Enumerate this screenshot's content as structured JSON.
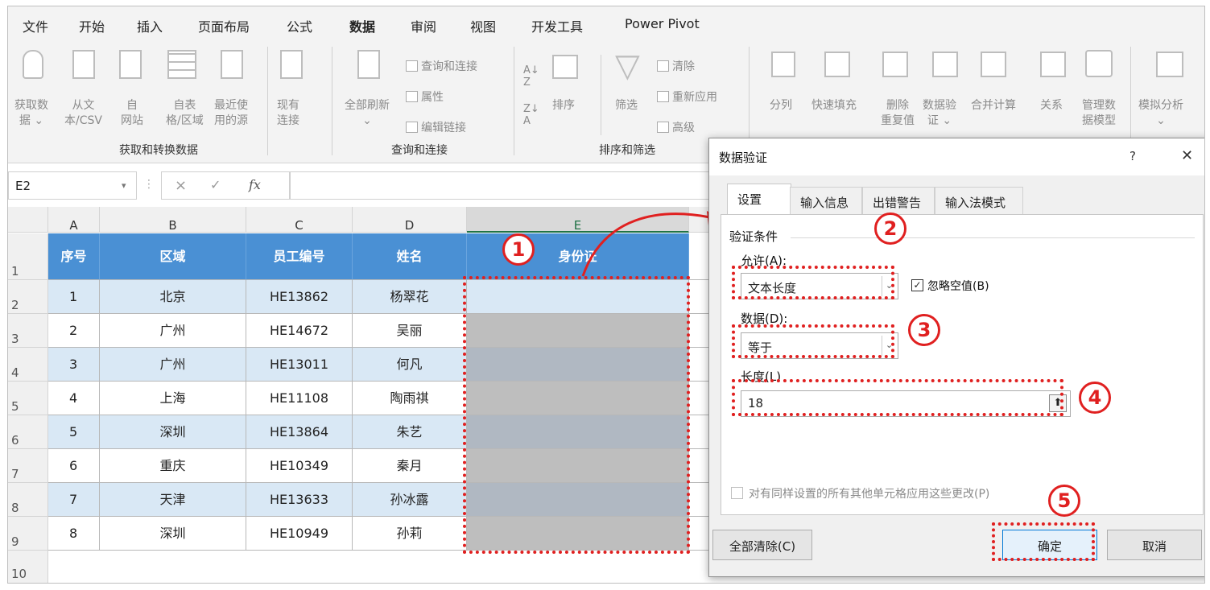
{
  "menu": {
    "tabs": [
      "文件",
      "开始",
      "插入",
      "页面布局",
      "公式",
      "数据",
      "审阅",
      "视图",
      "开发工具",
      "Power Pivot"
    ],
    "active_index": 5
  },
  "ribbon": {
    "get_data": {
      "l1": "获取数",
      "l2": "据 ⌄"
    },
    "from_text": {
      "l1": "从文",
      "l2": "本/CSV"
    },
    "from_web": {
      "l1": "自",
      "l2": "网站"
    },
    "from_table": {
      "l1": "自表",
      "l2": "格/区域"
    },
    "recent": {
      "l1": "最近使",
      "l2": "用的源"
    },
    "existing": {
      "l1": "现有",
      "l2": "连接"
    },
    "group1": "获取和转换数据",
    "refresh_all": {
      "l1": "全部刷新",
      "l2": "⌄"
    },
    "queries": "查询和连接",
    "properties": "属性",
    "edit_links": "编辑链接",
    "group2": "查询和连接",
    "sort": "排序",
    "filter": "筛选",
    "clear": "清除",
    "reapply": "重新应用",
    "advanced": "高级",
    "group3": "排序和筛选",
    "split": "分列",
    "flash_fill": "快速填充",
    "remove_dup": {
      "l1": "删除",
      "l2": "重复值"
    },
    "data_validation": {
      "l1": "数据验",
      "l2": "证 ⌄"
    },
    "consolidate": "合并计算",
    "relationships": "关系",
    "data_model": {
      "l1": "管理数",
      "l2": "据模型"
    },
    "what_if": {
      "l1": "模拟分析",
      "l2": "⌄"
    }
  },
  "formula_bar": {
    "name_box": "E2",
    "fx": "fx"
  },
  "sheet": {
    "columns": [
      "A",
      "B",
      "C",
      "D",
      "E"
    ],
    "rows": [
      "1",
      "2",
      "3",
      "4",
      "5",
      "6",
      "7",
      "8",
      "9",
      "10"
    ],
    "headers": [
      "序号",
      "区域",
      "员工编号",
      "姓名",
      "身份证"
    ],
    "data": [
      [
        "1",
        "北京",
        "HE13862",
        "杨翠花",
        ""
      ],
      [
        "2",
        "广州",
        "HE14672",
        "吴丽",
        ""
      ],
      [
        "3",
        "广州",
        "HE13011",
        "何凡",
        ""
      ],
      [
        "4",
        "上海",
        "HE11108",
        "陶雨祺",
        ""
      ],
      [
        "5",
        "深圳",
        "HE13864",
        "朱艺",
        ""
      ],
      [
        "6",
        "重庆",
        "HE10349",
        "秦月",
        ""
      ],
      [
        "7",
        "天津",
        "HE13633",
        "孙冰露",
        ""
      ],
      [
        "8",
        "深圳",
        "HE10949",
        "孙莉",
        ""
      ]
    ]
  },
  "dialog": {
    "title": "数据验证",
    "help": "?",
    "close": "✕",
    "tabs": [
      "设置",
      "输入信息",
      "出错警告",
      "输入法模式"
    ],
    "section": "验证条件",
    "allow_label": "允许(A):",
    "allow_value": "文本长度",
    "ignore_blank": "忽略空值(B)",
    "data_label": "数据(D):",
    "data_value": "等于",
    "length_label": "长度(L)",
    "length_value": "18",
    "apply_all": "对有同样设置的所有其他单元格应用这些更改(P)",
    "clear_all": "全部清除(C)",
    "ok": "确定",
    "cancel": "取消"
  },
  "annotations": [
    "1",
    "2",
    "3",
    "4",
    "5"
  ],
  "colors": {
    "header_fill": "#4a90d4",
    "band_fill": "#d9e8f5",
    "annotation": "#e02020",
    "excel_green": "#217346"
  }
}
